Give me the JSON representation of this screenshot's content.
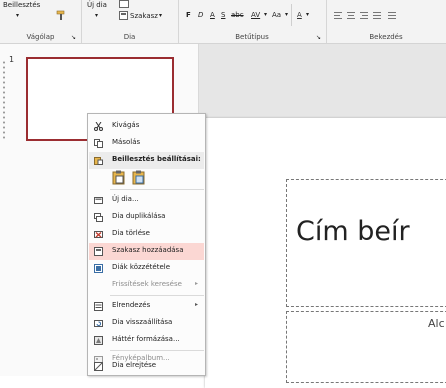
{
  "ribbon": {
    "beillesztes": "Beillesztés",
    "uj_dia": "Új dia",
    "szakasz": "Szakasz",
    "vagolap": "Vágólap",
    "dia": "Dia",
    "betutipus": "Betűtípus",
    "bekezdes": "Bekezdés",
    "font_bold": "F",
    "font_italic": "D",
    "font_underline": "A",
    "font_strike": "S",
    "font_abc": "abc",
    "font_spacing": "AV",
    "font_case": "Aa",
    "font_color": "A"
  },
  "slide_panel": {
    "slide_number": "1"
  },
  "slide": {
    "title_placeholder": "Cím beír",
    "subtitle_placeholder": "Alc"
  },
  "context_menu": {
    "items": [
      {
        "label": "Kivágás",
        "icon": "scissors-icon"
      },
      {
        "label": "Másolás",
        "icon": "copy-icon"
      },
      {
        "label": "Beillesztés beállításai:",
        "icon": "paste-icon"
      },
      {
        "label": "Új dia...",
        "icon": "new-slide-icon"
      },
      {
        "label": "Dia duplikálása",
        "icon": "duplicate-slide-icon"
      },
      {
        "label": "Dia törlése",
        "icon": "delete-slide-icon"
      },
      {
        "label": "Szakasz hozzáadása",
        "icon": "add-section-icon"
      },
      {
        "label": "Diák közzététele",
        "icon": "publish-slides-icon"
      },
      {
        "label": "Frissítések keresése",
        "icon": ""
      },
      {
        "label": "Elrendezés",
        "icon": "layout-icon"
      },
      {
        "label": "Dia visszaállítása",
        "icon": "reset-slide-icon"
      },
      {
        "label": "Háttér formázása...",
        "icon": "format-background-icon"
      },
      {
        "label": "Fényképalbum...",
        "icon": "photo-album-icon"
      },
      {
        "label": "Dia elrejtése",
        "icon": "hide-slide-icon"
      }
    ],
    "submenu_arrow": "▸"
  }
}
